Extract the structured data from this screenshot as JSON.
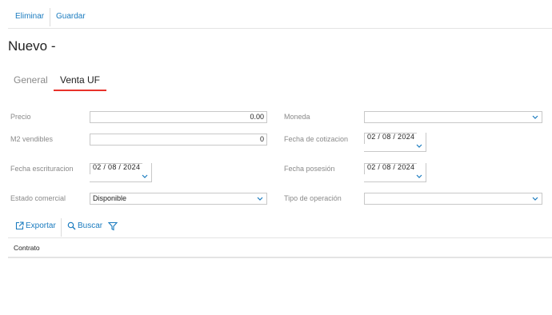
{
  "toolbar": {
    "delete_label": "Eliminar",
    "save_label": "Guardar"
  },
  "page": {
    "title": "Nuevo -"
  },
  "tabs": [
    {
      "label": "General",
      "active": false
    },
    {
      "label": "Venta UF",
      "active": true
    }
  ],
  "form": {
    "precio": {
      "label": "Precio",
      "value": "0.00"
    },
    "moneda": {
      "label": "Moneda",
      "value": ""
    },
    "m2_vendibles": {
      "label": "M2 vendibles",
      "value": "0"
    },
    "fecha_cotizacion": {
      "label": "Fecha de cotizacion",
      "value": "02 / 08 /  2024"
    },
    "fecha_escrituracion": {
      "label": "Fecha escrituracion",
      "value": "02 / 08 /  2024"
    },
    "fecha_posesion": {
      "label": "Fecha posesión",
      "value": "02 / 08 /  2024"
    },
    "estado_comercial": {
      "label": "Estado comercial",
      "value": "Disponible"
    },
    "tipo_operacion": {
      "label": "Tipo de operación",
      "value": ""
    }
  },
  "grid": {
    "export_label": "Exportar",
    "search_label": "Buscar",
    "columns": [
      "Contrato"
    ]
  },
  "colors": {
    "accent": "#1a7bbf",
    "active_tab": "#e8322b"
  }
}
